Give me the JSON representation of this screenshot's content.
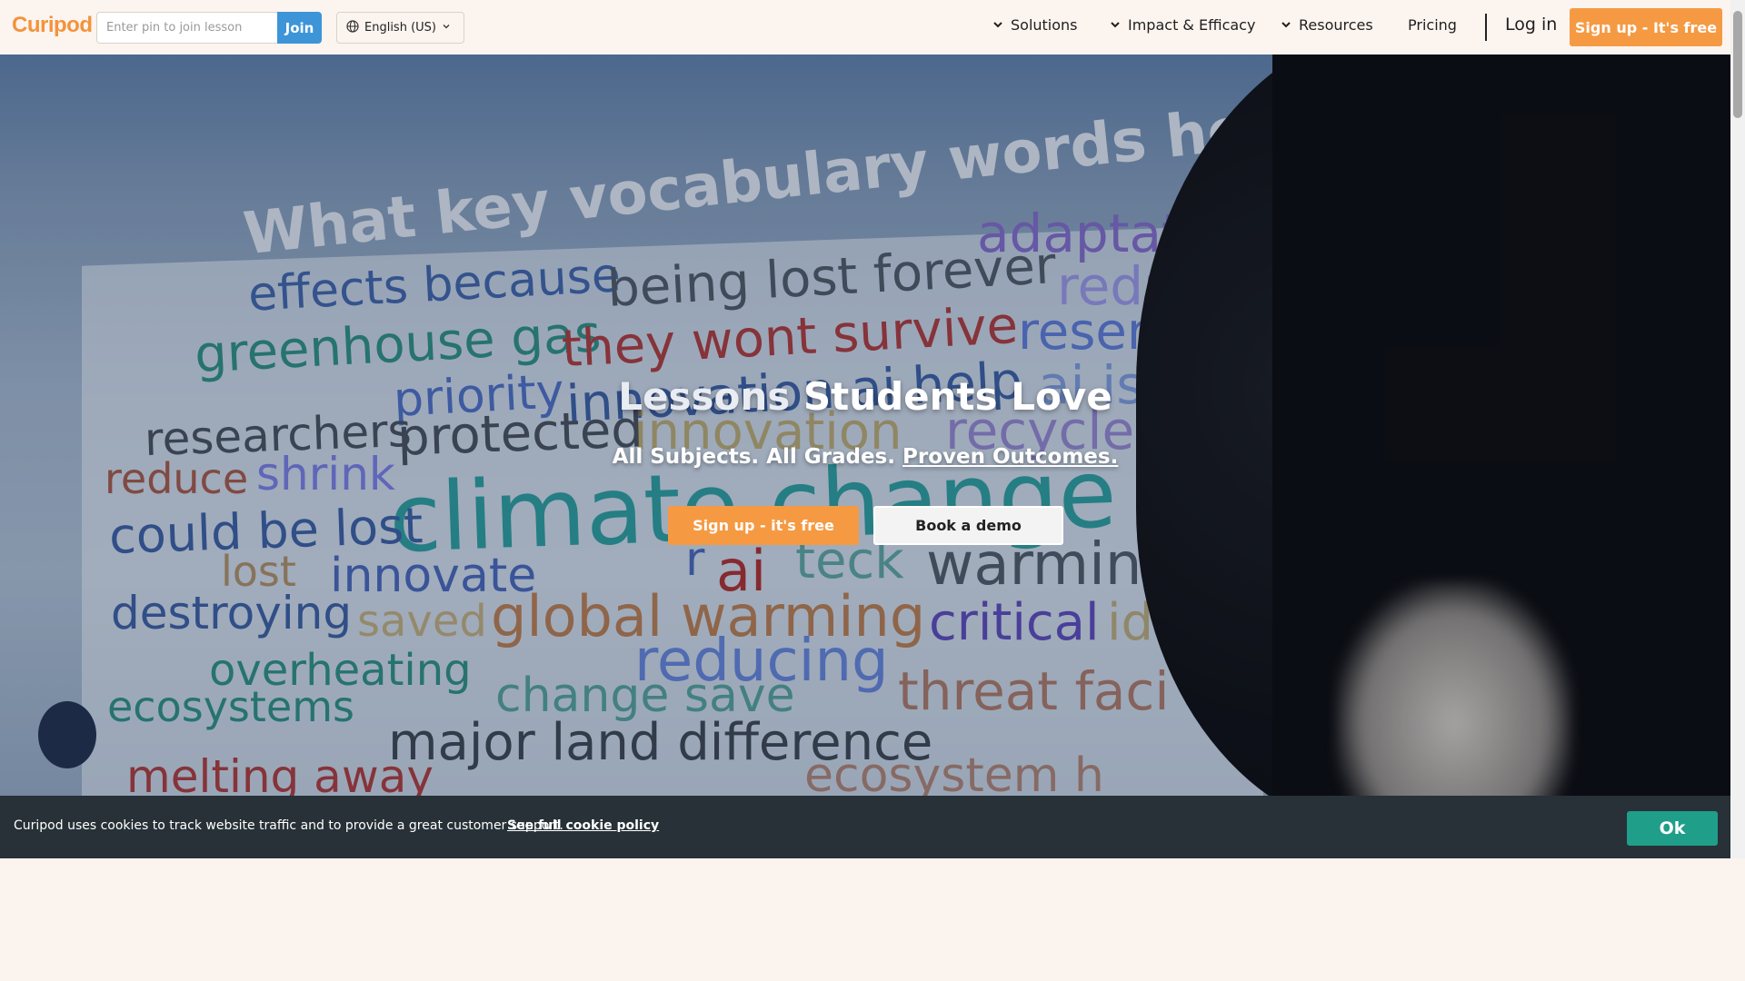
{
  "header": {
    "logo": "Curipod",
    "pin_placeholder": "Enter pin to join lesson",
    "pin_value": "",
    "join_label": "Join",
    "language": "English (US)",
    "nav": [
      {
        "label": "Solutions"
      },
      {
        "label": "Impact & Efficacy"
      },
      {
        "label": "Resources"
      },
      {
        "label": "Pricing"
      }
    ],
    "login_label": "Log in",
    "signup_label": "Sign up - It's free"
  },
  "hero": {
    "title_part1": "Lessons",
    "title_part2": "Students Love",
    "subtitle": "All Subjects. All Grades.",
    "subtitle_link": "Proven Outcomes.",
    "cta_primary": "Sign up - it's free",
    "cta_secondary": "Book a demo",
    "video_words": {
      "question": "What key vocabulary words help to",
      "words": [
        "adaptatio",
        "effects because",
        "being lost forever",
        "reduc",
        "greenhouse gas",
        "they wont survive",
        "reserve",
        "priority",
        "innovation ai help",
        "ai is h",
        "researchers",
        "protected",
        "innovation",
        "recycle",
        "in",
        "reduce",
        "shrink",
        "climate change",
        "could be lost",
        "lost",
        "innovate",
        "r",
        "ai",
        "teck",
        "warming",
        "destroying",
        "saved",
        "global warming",
        "critical",
        "ide",
        "overheating",
        "reducing",
        "ecosystems",
        "change save",
        "threat faci",
        "major land difference",
        "melting away",
        "ecosystem h"
      ]
    }
  },
  "cookie": {
    "text": "Curipod uses cookies to track website traffic and to provide a great customer support.",
    "link": "See full cookie policy",
    "ok": "Ok"
  },
  "colors": {
    "brand_orange": "#f59a43",
    "join_blue": "#3d95d8",
    "cookie_bg": "#273137",
    "ok_teal": "#1f9e8a"
  }
}
